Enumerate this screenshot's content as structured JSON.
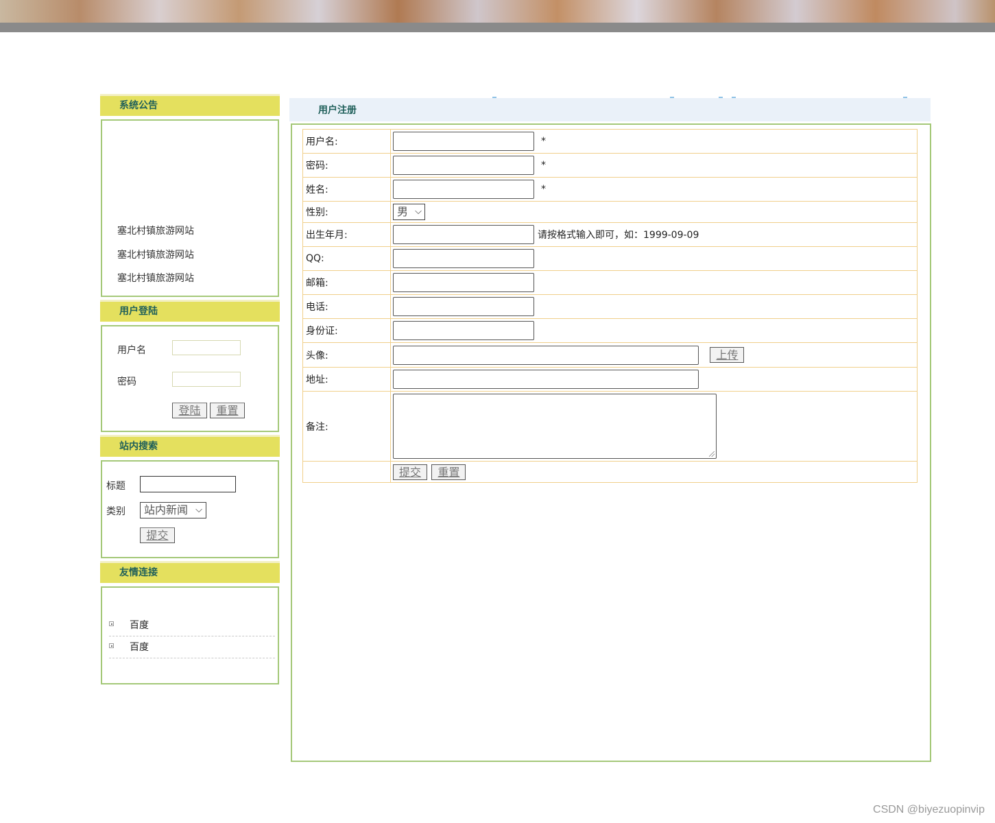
{
  "notice": {
    "title": "系统公告",
    "items": [
      "塞北村镇旅游网站",
      "塞北村镇旅游网站",
      "塞北村镇旅游网站"
    ]
  },
  "login": {
    "title": "用户登陆",
    "username_label": "用户名",
    "password_label": "密码",
    "login_button": "登陆",
    "reset_button": "重置"
  },
  "search": {
    "title": "站内搜索",
    "title_label": "标题",
    "category_label": "类别",
    "category_selected": "站内新闻",
    "submit_button": "提交"
  },
  "links": {
    "title": "友情连接",
    "items": [
      "百度",
      "百度"
    ]
  },
  "register": {
    "title": "用户注册",
    "required_mark": "*",
    "fields": {
      "username": "用户名:",
      "password": "密码:",
      "name": "姓名:",
      "gender": "性别:",
      "birth": "出生年月:",
      "qq": "QQ:",
      "email": "邮箱:",
      "phone": "电话:",
      "idcard": "身份证:",
      "avatar": "头像:",
      "address": "地址:",
      "remark": "备注:"
    },
    "gender_selected": "男",
    "birth_hint": "请按格式输入即可，如：1999-09-09",
    "upload_button": "上传",
    "submit_button": "提交",
    "reset_button": "重置"
  },
  "footer": {
    "credit": "CSDN @biyezuopinvip"
  }
}
